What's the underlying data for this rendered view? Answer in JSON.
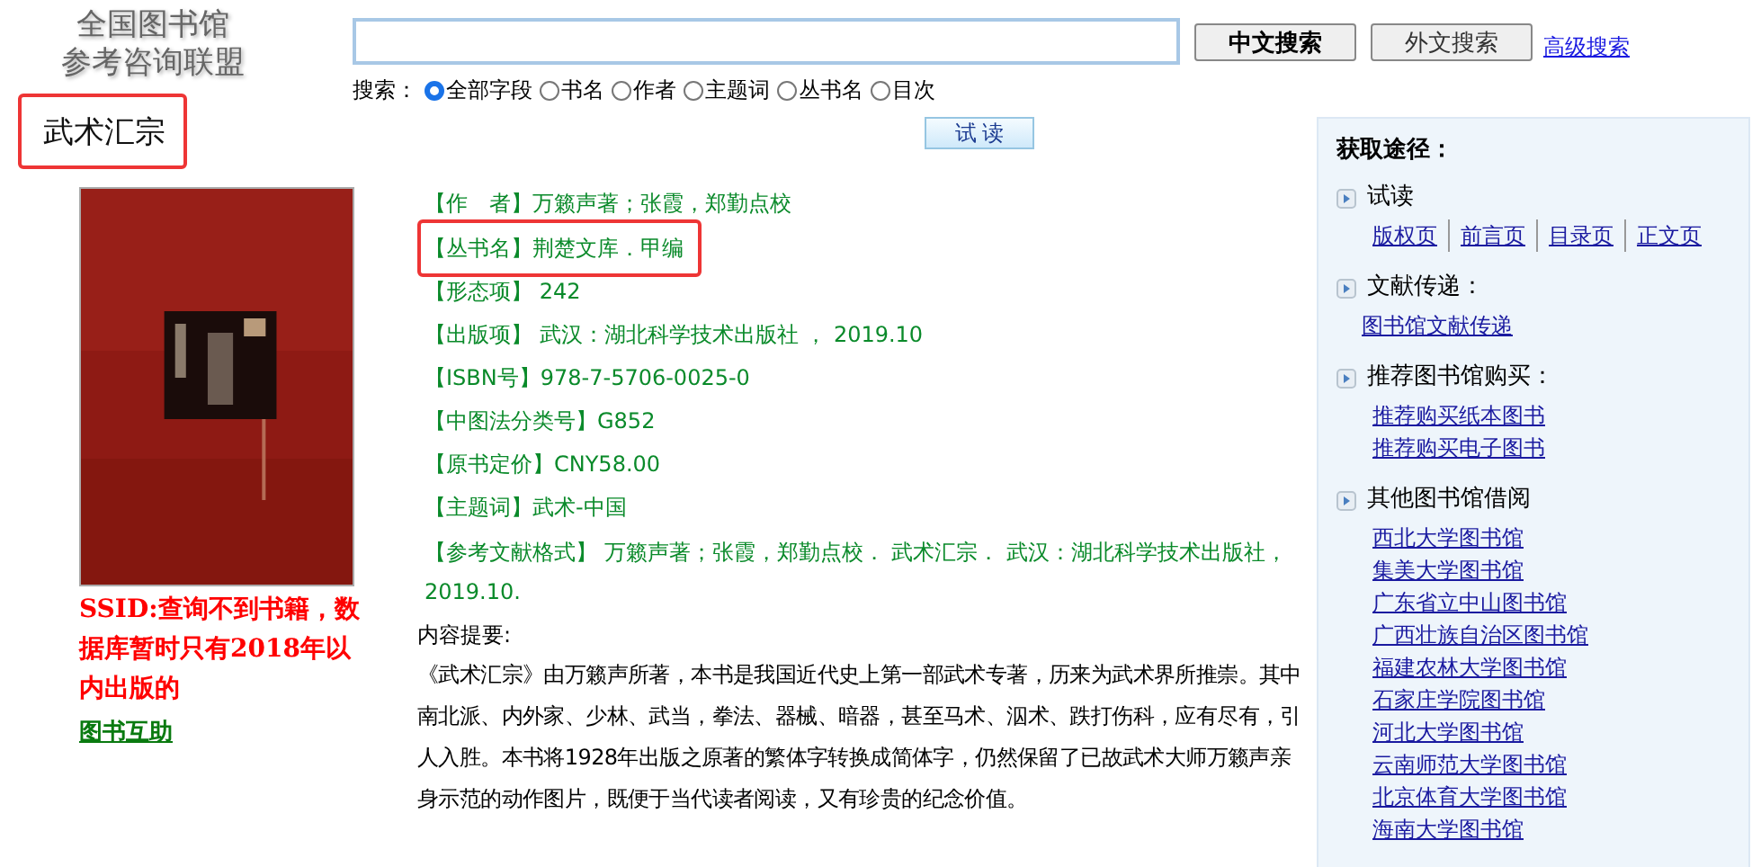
{
  "logo": {
    "lines": [
      "全国图书馆",
      "参考咨询联盟"
    ]
  },
  "title_callout": {
    "text": "武术汇宗"
  },
  "search": {
    "buttons": [
      {
        "label": "中文搜索",
        "primary": true
      },
      {
        "label": "外文搜索",
        "primary": false
      }
    ],
    "advanced_link": "高级搜索",
    "field_label": "搜索：",
    "options": [
      {
        "label": "全部字段",
        "selected": true
      },
      {
        "label": "书名",
        "selected": false
      },
      {
        "label": "作者",
        "selected": false
      },
      {
        "label": "主题词",
        "selected": false
      },
      {
        "label": "丛书名",
        "selected": false
      },
      {
        "label": "目次",
        "selected": false
      }
    ]
  },
  "preview_button": "试 读",
  "note": {
    "text": "SSID:查询不到书籍，数据库暂时只有2018年以内出版的",
    "link": "图书互助"
  },
  "fields": [
    {
      "label": "【作　者】",
      "value": "万籁声著；张霞，郑勤点校",
      "highlighted": false
    },
    {
      "label": "【丛书名】",
      "value": "荆楚文库．甲编",
      "highlighted": true
    },
    {
      "label": "【形态项】",
      "value": " 242",
      "highlighted": false
    },
    {
      "label": "【出版项】",
      "value": " 武汉：湖北科学技术出版社 ， 2019.10",
      "highlighted": false
    },
    {
      "label": "【ISBN号】",
      "value": "978-7-5706-0025-0",
      "highlighted": false
    },
    {
      "label": "【中图法分类号】",
      "value": "G852",
      "highlighted": false
    },
    {
      "label": "【原书定价】",
      "value": "CNY58.00",
      "highlighted": false
    },
    {
      "label": "【主题词】",
      "value": "武术-中国",
      "highlighted": false
    },
    {
      "label": "【参考文献格式】",
      "value": " 万籁声著；张霞，郑勤点校． 武术汇宗． 武汉：湖北科学技术出版社， 2019.10.",
      "highlighted": false
    }
  ],
  "summary": {
    "label": "内容提要:",
    "text": "《武术汇宗》由万籁声所著，本书是我国近代史上第一部武术专著，历来为武术界所推崇。其中南北派、内外家、少林、武当，拳法、器械、暗器，甚至马术、泅术、跌打伤科，应有尽有，引人入胜。本书将1928年出版之原著的繁体字转换成简体字，仍然保留了已故武术大师万籁声亲身示范的动作图片，既便于当代读者阅读，又有珍贵的纪念价值。"
  },
  "sidebar": {
    "title": "获取途径：",
    "sections": [
      {
        "heading": "试读",
        "kind": "inline",
        "links": [
          "版权页",
          "前言页",
          "目录页 ",
          "正文页"
        ]
      },
      {
        "heading": "文献传递：",
        "kind": "list",
        "links": [
          "图书馆文献传递"
        ]
      },
      {
        "heading": "推荐图书馆购买：",
        "kind": "list",
        "links": [
          "推荐购买纸本图书",
          "推荐购买电子图书"
        ]
      },
      {
        "heading": "其他图书馆借阅",
        "kind": "list",
        "links": [
          "西北大学图书馆",
          "集美大学图书馆",
          "广东省立中山图书馆",
          "广西壮族自治区图书馆",
          "福建农林大学图书馆",
          "石家庄学院图书馆",
          "河北大学图书馆",
          "云南师范大学图书馆",
          "北京体育大学图书馆",
          "海南大学图书馆"
        ]
      }
    ]
  }
}
